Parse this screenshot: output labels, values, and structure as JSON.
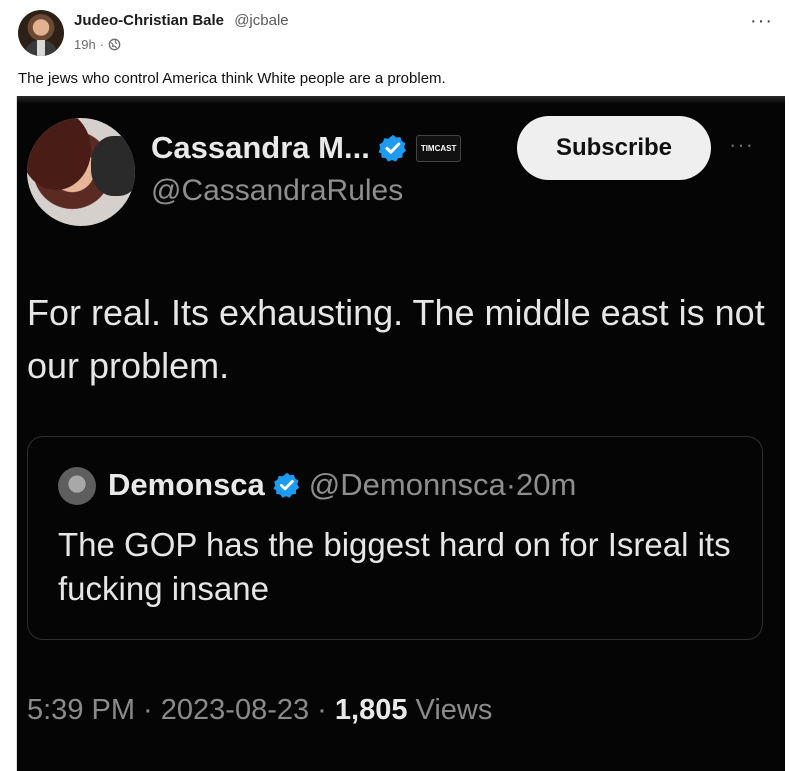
{
  "post": {
    "author_name": "Judeo-Christian Bale",
    "author_handle": "@jcbale",
    "time_ago": "19h",
    "separator": "·",
    "more_label": "···",
    "caption": "The jews who control America think White people are a problem."
  },
  "embedded": {
    "author_name": "Cassandra M...",
    "badge_label": "TIMCAST",
    "author_handle": "@CassandraRules",
    "subscribe_label": "Subscribe",
    "more_label": "···",
    "tweet_text": "For real. Its exhausting. The middle east is not our problem.",
    "quote": {
      "name": "Demonsca",
      "handle": "@Demonnsca",
      "separator": "·",
      "time_ago": "20m",
      "text": "The GOP has the biggest hard on for Isreal its fucking insane"
    },
    "footer": {
      "time": "5:39 PM",
      "separator1": " · ",
      "date": "2023-08-23",
      "separator2": " · ",
      "views_count": "1,805",
      "views_label": " Views"
    },
    "colors": {
      "verified": "#1d9bf0",
      "background": "#050505"
    }
  },
  "icons": {
    "globe": "globe-icon",
    "verified": "verified-icon",
    "more": "more-icon"
  }
}
